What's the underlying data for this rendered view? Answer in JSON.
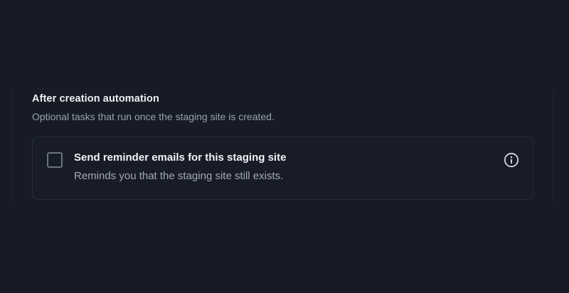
{
  "section": {
    "title": "After creation automation",
    "description": "Optional tasks that run once the staging site is created."
  },
  "option": {
    "label": "Send reminder emails for this staging site",
    "description": "Reminds you that the staging site still exists.",
    "checked": false,
    "icon": "info-circle-icon"
  },
  "colors": {
    "background": "#171b26",
    "text_primary": "#eef0f4",
    "text_secondary": "#9aa1ad",
    "border": "#262c3a"
  }
}
